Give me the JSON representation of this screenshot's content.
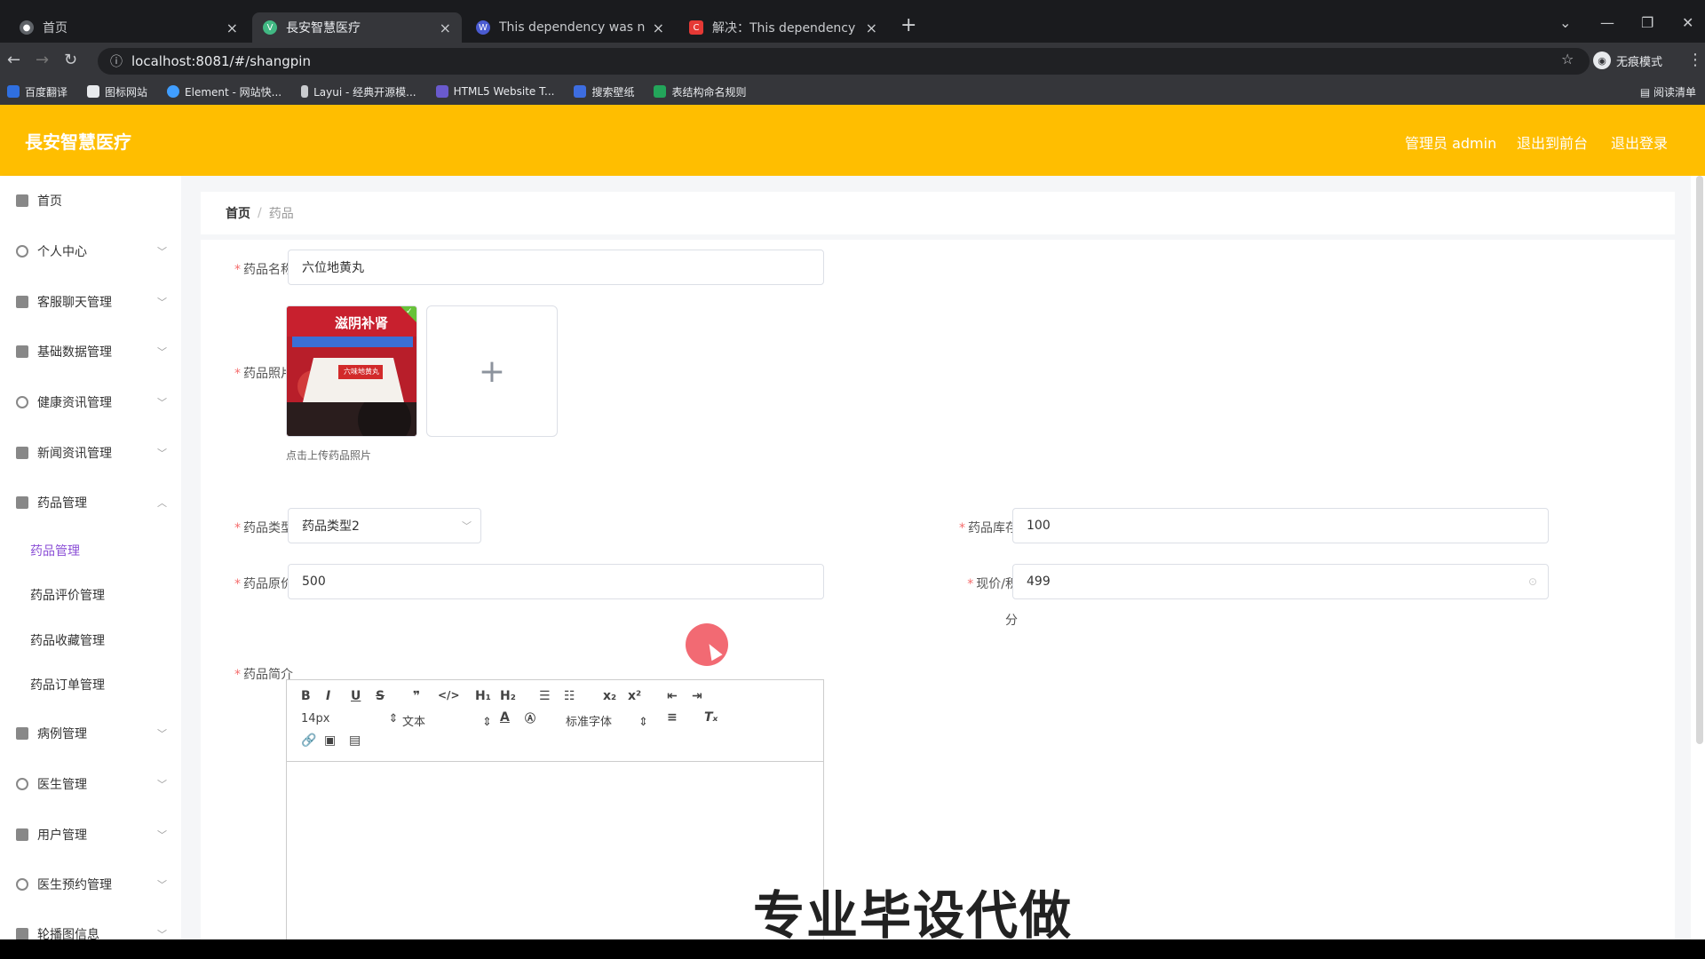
{
  "browser": {
    "tabs": [
      {
        "label": "首页",
        "color": "#5f6368"
      },
      {
        "label": "長安智慧医疗",
        "color": "#41b883"
      },
      {
        "label": "This dependency was not fou",
        "color": "#4a5bd1"
      },
      {
        "label": "解决：This dependency was n",
        "color": "#e53935"
      }
    ],
    "url": "localhost:8081/#/shangpin",
    "incognito_label": "无痕模式",
    "bookmarks": [
      "百度翻译",
      "图标网站",
      "Element - 网站快...",
      "Layui - 经典开源模...",
      "HTML5 Website T...",
      "搜索壁纸",
      "表结构命名规则"
    ],
    "reading_list": "阅读清单"
  },
  "header": {
    "title": "長安智慧医疗",
    "admin": "管理员 admin",
    "back_frontend": "退出到前台",
    "logout": "退出登录",
    "color": "#ffbe00"
  },
  "sidebar": {
    "items": [
      {
        "label": "首页"
      },
      {
        "label": "个人中心"
      },
      {
        "label": "客服聊天管理"
      },
      {
        "label": "基础数据管理"
      },
      {
        "label": "健康资讯管理"
      },
      {
        "label": "新闻资讯管理"
      },
      {
        "label": "药品管理"
      },
      {
        "label": "病例管理"
      },
      {
        "label": "医生管理"
      },
      {
        "label": "用户管理"
      },
      {
        "label": "医生预约管理"
      },
      {
        "label": "轮播图信息"
      }
    ],
    "subitems": [
      "药品管理",
      "药品评价管理",
      "药品收藏管理",
      "药品订单管理"
    ],
    "active_color": "#8b4fd6"
  },
  "breadcrumb": {
    "home": "首页",
    "sep": "/",
    "current": "药品"
  },
  "form": {
    "name_label": "药品名称",
    "name_value": "六位地黄丸",
    "photo_label": "药品照片",
    "photo_hint": "点击上传药品照片",
    "photo_caption": "滋阴补肾",
    "photo_box_text": "六味地黄丸",
    "type_label": "药品类型",
    "type_value": "药品类型2",
    "stock_label": "药品库存",
    "stock_value": "100",
    "price_label": "药品原价",
    "price_value": "500",
    "current_label": "现价/积",
    "current_label_wrap": "分",
    "current_value": "499",
    "intro_label": "药品简介",
    "editor": {
      "font_size": "14px",
      "text_style": "文本",
      "font_family": "标准字体"
    }
  },
  "overlay": {
    "watermark": "专业毕设代做"
  }
}
